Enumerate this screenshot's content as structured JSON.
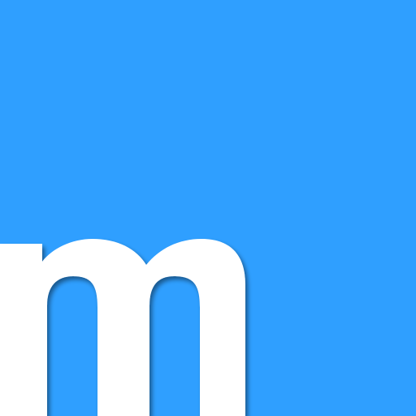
{
  "logo": {
    "letter": "m"
  },
  "colors": {
    "background": "#2f9fff",
    "letter": "#ffffff",
    "shadow": "#1c6fbf"
  }
}
